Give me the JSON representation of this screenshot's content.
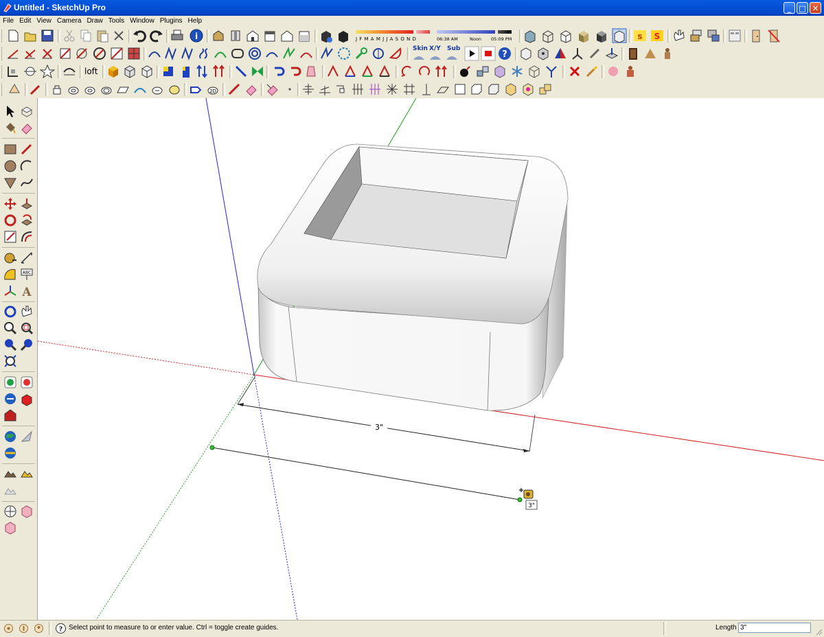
{
  "window": {
    "title": "Untitled - SketchUp Pro",
    "minimize": "_",
    "maximize": "□",
    "close": "✕"
  },
  "menu": [
    "File",
    "Edit",
    "View",
    "Camera",
    "Draw",
    "Tools",
    "Window",
    "Plugins",
    "Help"
  ],
  "shadow_bar": {
    "months": "J F M A M J J A S O N D",
    "time_start": "06:38 AM",
    "time_mid": "Noon",
    "time_end": "05:09 PM"
  },
  "toolbar_text": {
    "loft": "loft",
    "skin": "Skin",
    "xy": "X/Y",
    "sub": "Sub"
  },
  "viewport": {
    "dimension_label": "3\"",
    "cursor_tooltip": "3\""
  },
  "status": {
    "hint": "Select point to measure to or enter value.  Ctrl = toggle create guides.",
    "vcb_label": "Length",
    "vcb_value": "3\""
  },
  "colors": {
    "title_bar": "#0351d6",
    "toolbar_bg": "#ece9d8",
    "red_axis": "#d42020",
    "green_axis": "#18a818",
    "blue_axis": "#2424d8"
  },
  "icons": {
    "row1": [
      "new-icon",
      "open-icon",
      "save-icon",
      "cut-icon",
      "copy-icon",
      "paste-icon",
      "erase-icon",
      "undo-icon",
      "redo-icon",
      "print-icon",
      "model-info-icon",
      "iso-view-icon",
      "top-view-icon",
      "front-view-icon",
      "right-view-icon",
      "back-view-icon",
      "left-view-icon",
      "shadows-icon",
      "fog-icon",
      "xray-icon",
      "wireframe-icon",
      "hidden-line-icon",
      "shaded-icon",
      "textured-icon",
      "monochrome-icon",
      "plugin-s-icon",
      "plugin-s2-icon",
      "hand-icon",
      "layers-icon",
      "components-icon",
      "outliner-icon",
      "door-icon",
      "no-door-icon"
    ]
  }
}
